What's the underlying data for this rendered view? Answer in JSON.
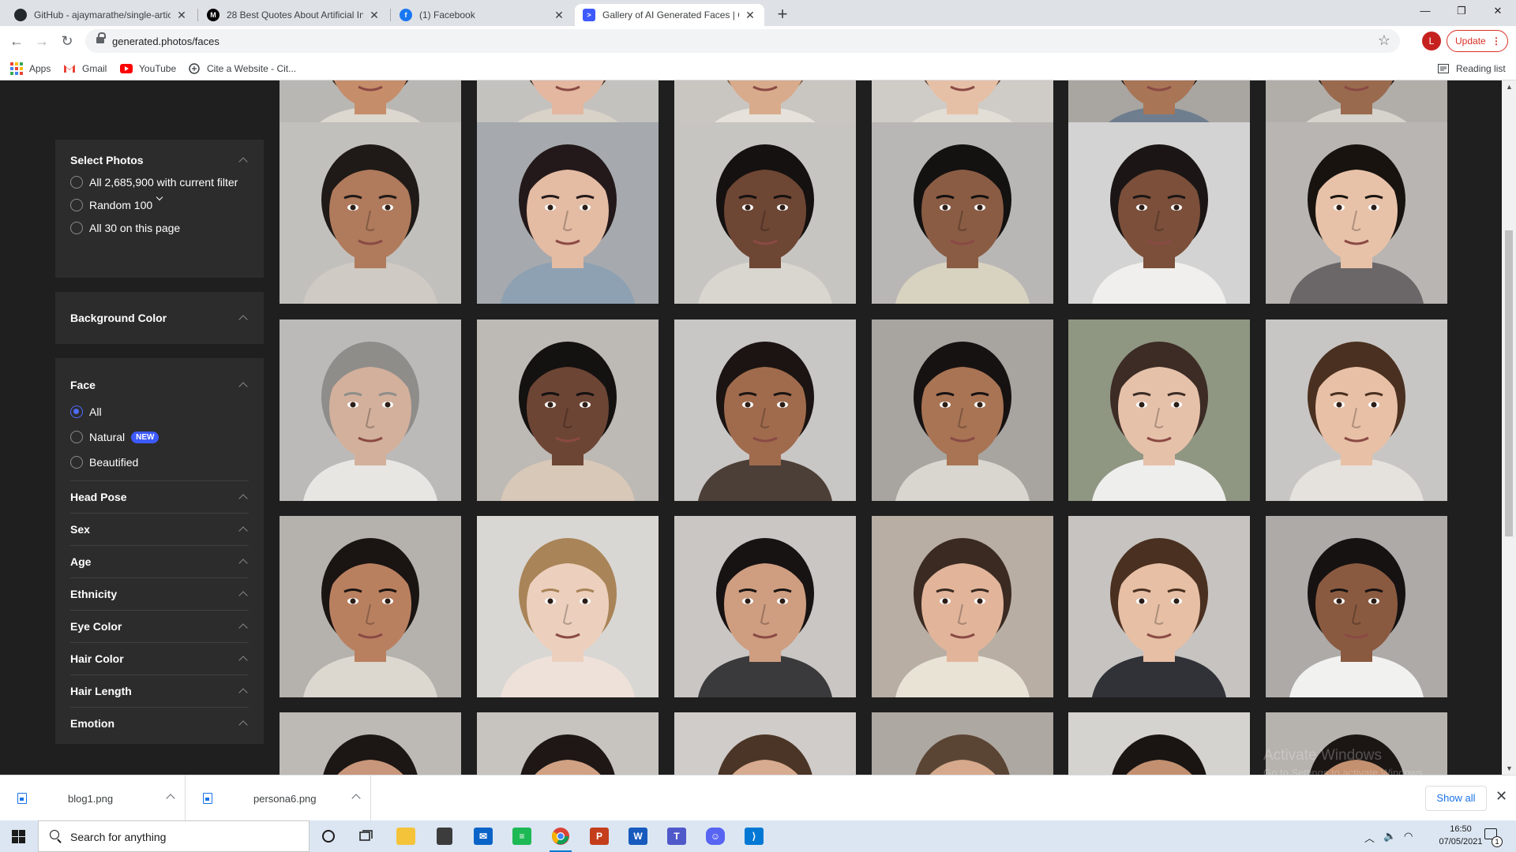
{
  "browser": {
    "tabs": [
      {
        "title": "GitHub - ajaymarathe/single-artic",
        "icon": "github-icon",
        "color": "#24292e",
        "glyph": ""
      },
      {
        "title": "28 Best Quotes About Artificial In",
        "icon": "medium-icon",
        "color": "#000000",
        "glyph": "M"
      },
      {
        "title": "(1) Facebook",
        "icon": "facebook-icon",
        "color": "#1877f2",
        "glyph": "f"
      },
      {
        "title": "Gallery of AI Generated Faces | G",
        "icon": "generated-photos-icon",
        "color": "#3d5afe",
        "glyph": ">"
      }
    ],
    "url": "generated.photos/faces",
    "profile_initial": "L",
    "update_label": "Update",
    "bookmarks": [
      {
        "label": "Apps",
        "icon": "apps-grid-icon"
      },
      {
        "label": "Gmail",
        "icon": "gmail-icon"
      },
      {
        "label": "YouTube",
        "icon": "youtube-icon"
      },
      {
        "label": "Cite a Website - Cit...",
        "icon": "cite-icon"
      }
    ],
    "reading_list": "Reading list"
  },
  "sidebar": {
    "select_photos": {
      "title": "Select Photos",
      "options": [
        {
          "label": "All 2,685,900 with current filter",
          "selected": false
        },
        {
          "label": "Random 100",
          "selected": false,
          "dropdown": true
        },
        {
          "label": "All 30 on this page",
          "selected": false
        }
      ]
    },
    "background_color": {
      "title": "Background Color"
    },
    "face": {
      "title": "Face",
      "options": [
        {
          "label": "All",
          "selected": true
        },
        {
          "label": "Natural",
          "selected": false,
          "badge": "NEW"
        },
        {
          "label": "Beautified",
          "selected": false
        }
      ]
    },
    "sections": [
      "Head Pose",
      "Sex",
      "Age",
      "Ethnicity",
      "Eye Color",
      "Hair Color",
      "Hair Length",
      "Emotion"
    ]
  },
  "gallery": {
    "faces": [
      {
        "skin": "#c68d6a",
        "hair": "#2a1d17",
        "bg": "#b9b7b3",
        "shirt": "#dcd7cf"
      },
      {
        "skin": "#e3b7a0",
        "hair": "#3c2a20",
        "bg": "#c4c2bf",
        "shirt": "#d9d2c8"
      },
      {
        "skin": "#d8ab8c",
        "hair": "#7a5a40",
        "bg": "#c9c6c2",
        "shirt": "#e6e1da"
      },
      {
        "skin": "#e6c0a6",
        "hair": "#5a3e2c",
        "bg": "#cfccc8",
        "shirt": "#e2ddd5"
      },
      {
        "skin": "#a87556",
        "hair": "#1e1613",
        "bg": "#a9a6a2",
        "shirt": "#6f7e8f"
      },
      {
        "skin": "#9a6a4e",
        "hair": "#1d1512",
        "bg": "#b1aeaa",
        "shirt": "#d6d2cc"
      },
      {
        "skin": "#b07a5c",
        "hair": "#1f1a17",
        "bg": "#c2c0bd",
        "shirt": "#cfcac3"
      },
      {
        "skin": "#e4bba3",
        "hair": "#23191a",
        "bg": "#a6a9ad",
        "shirt": "#8ea1b3"
      },
      {
        "skin": "#6e4634",
        "hair": "#151110",
        "bg": "#c7c5c2",
        "shirt": "#d9d5cf"
      },
      {
        "skin": "#8a5c44",
        "hair": "#141111",
        "bg": "#b9b7b5",
        "shirt": "#d8d3c0"
      },
      {
        "skin": "#7b4f3a",
        "hair": "#1b1615",
        "bg": "#d3d3d3",
        "shirt": "#f0efed"
      },
      {
        "skin": "#e8c2a8",
        "hair": "#18130f",
        "bg": "#b8b5b2",
        "shirt": "#6b6768"
      },
      {
        "skin": "#d3b09c",
        "hair": "#8f8d8a",
        "bg": "#bcbab8",
        "shirt": "#e8e6e3"
      },
      {
        "skin": "#6d4535",
        "hair": "#141111",
        "bg": "#bdb9b4",
        "shirt": "#d8c8b8"
      },
      {
        "skin": "#a06b4d",
        "hair": "#1b1412",
        "bg": "#c9c7c5",
        "shirt": "#4c3f37"
      },
      {
        "skin": "#a87454",
        "hair": "#171212",
        "bg": "#a8a5a1",
        "shirt": "#d9d5cf"
      },
      {
        "skin": "#e6c1aa",
        "hair": "#3c2c25",
        "bg": "#8f9682",
        "shirt": "#eeeeec"
      },
      {
        "skin": "#e8c0a6",
        "hair": "#4a3020",
        "bg": "#c8c6c4",
        "shirt": "#e5e2de"
      },
      {
        "skin": "#b98060",
        "hair": "#1a1412",
        "bg": "#b5b1ac",
        "shirt": "#dcd7cf"
      },
      {
        "skin": "#ecd0bd",
        "hair": "#a98458",
        "bg": "#d9d7d4",
        "shirt": "#eee1da"
      },
      {
        "skin": "#cf9d80",
        "hair": "#181313",
        "bg": "#c9c6c3",
        "shirt": "#3a3a3c"
      },
      {
        "skin": "#e2b59b",
        "hair": "#3a2a22",
        "bg": "#b8aea4",
        "shirt": "#e9e3d6"
      },
      {
        "skin": "#e6bfa5",
        "hair": "#4a3020",
        "bg": "#c6c3c0",
        "shirt": "#303238"
      },
      {
        "skin": "#8a5a40",
        "hair": "#161212",
        "bg": "#adaaa7",
        "shirt": "#f1f1f0"
      },
      {
        "skin": "#c8967a",
        "hair": "#1c1614",
        "bg": "#bdbab6",
        "shirt": "#d6d1ca"
      },
      {
        "skin": "#d1a184",
        "hair": "#1e1715",
        "bg": "#c7c4c0",
        "shirt": "#d6d1ca"
      },
      {
        "skin": "#d7ab8f",
        "hair": "#4b3526",
        "bg": "#cfccc9",
        "shirt": "#d6d1ca"
      },
      {
        "skin": "#d6a98c",
        "hair": "#5a4535",
        "bg": "#aea8a2",
        "shirt": "#d6d1ca"
      },
      {
        "skin": "#c29070",
        "hair": "#1a1513",
        "bg": "#d5d3d0",
        "shirt": "#d6d1ca"
      },
      {
        "skin": "#c39070",
        "hair": "#1b1614",
        "bg": "#b6b3af",
        "shirt": "#d6d1ca"
      }
    ]
  },
  "watermark": {
    "line1": "Activate Windows",
    "line2": "Go to Settings to activate Windows."
  },
  "downloads": {
    "items": [
      "blog1.png",
      "persona6.png"
    ],
    "show_all": "Show all"
  },
  "taskbar": {
    "search_placeholder": "Search for anything",
    "time": "16:50",
    "date": "07/05/2021",
    "notification_count": "1"
  }
}
